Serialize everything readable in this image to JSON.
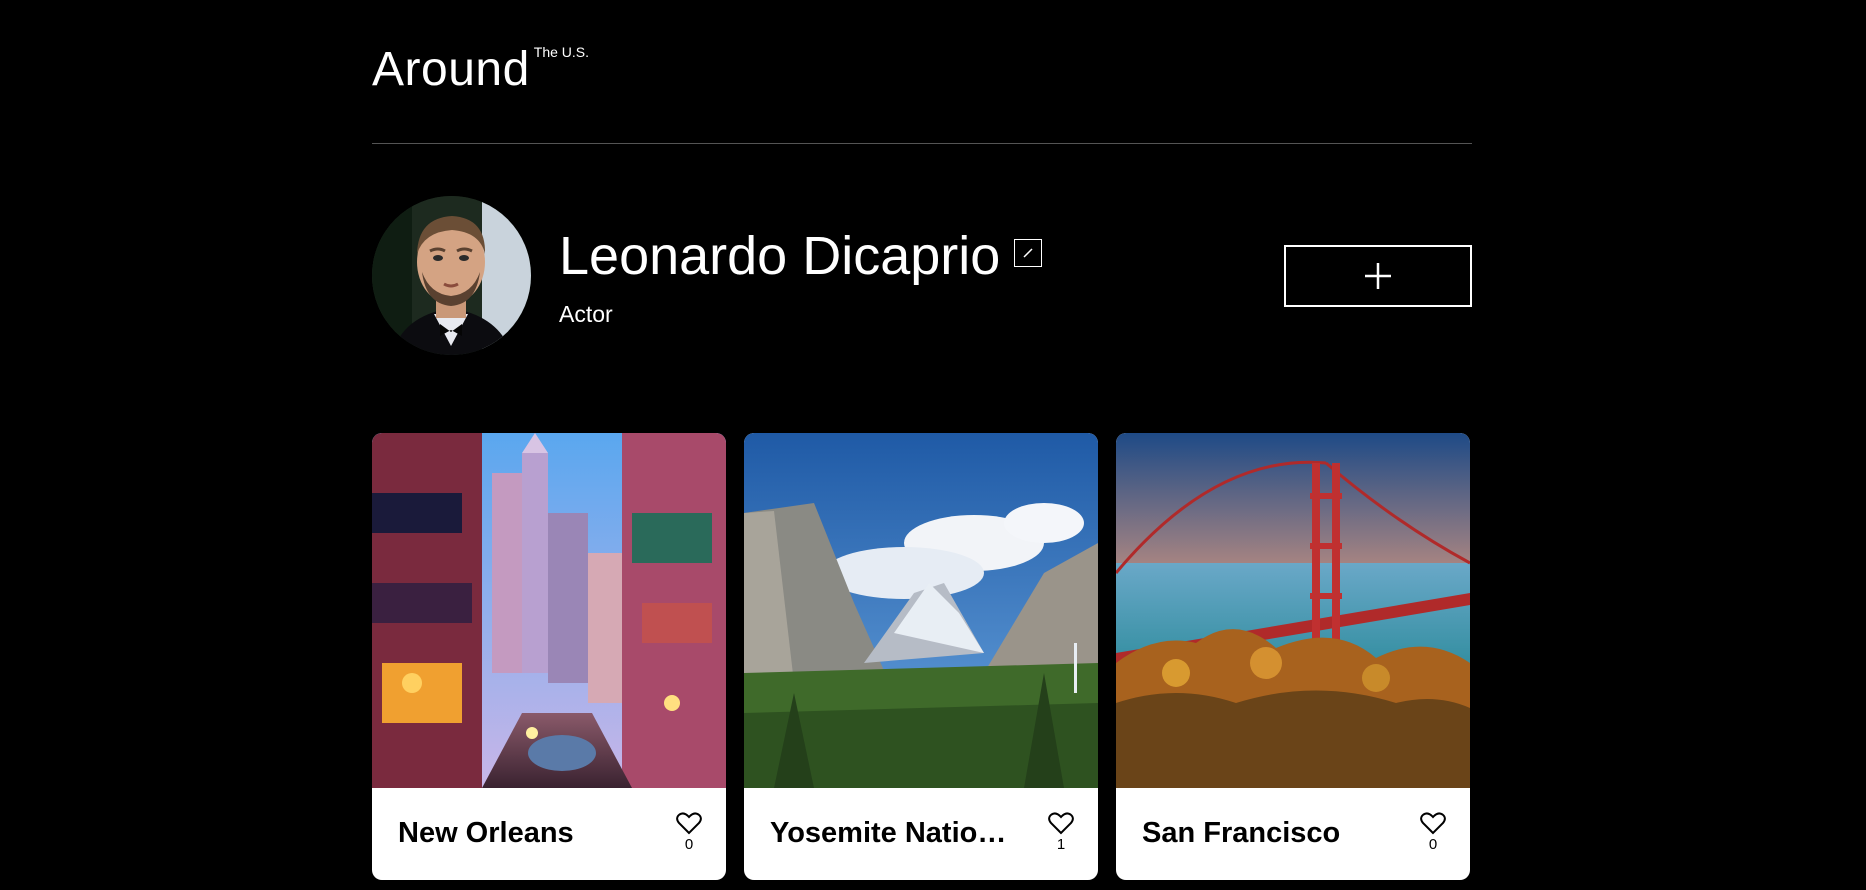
{
  "header": {
    "logo_main": "Around",
    "logo_sup": "The U.S."
  },
  "profile": {
    "name": "Leonardo Dicaprio",
    "about": "Actor",
    "edit_icon": "pencil-icon",
    "add_icon": "plus-icon"
  },
  "cards": [
    {
      "title": "New Orleans",
      "likes": "0",
      "image": "new-orleans-street-photo"
    },
    {
      "title": "Yosemite Nation…",
      "likes": "1",
      "image": "yosemite-valley-photo"
    },
    {
      "title": "San Francisco",
      "likes": "0",
      "image": "golden-gate-bridge-photo"
    }
  ],
  "colors": {
    "background": "#000000",
    "text": "#ffffff",
    "card": "#ffffff",
    "card_text": "#000000",
    "divider": "#545454"
  }
}
